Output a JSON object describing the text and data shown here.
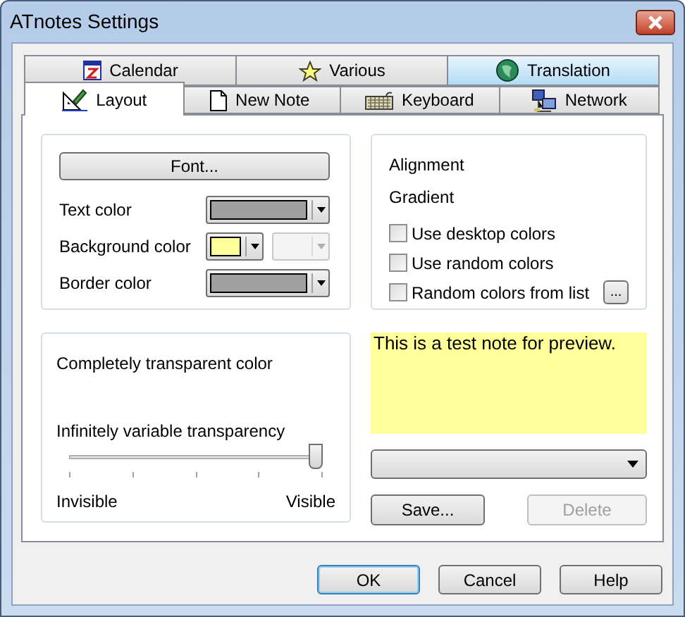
{
  "window": {
    "title": "ATnotes Settings"
  },
  "tab_rows": [
    [
      {
        "label": "Calendar",
        "selected": false,
        "highlighted": false
      },
      {
        "label": "Various",
        "selected": false,
        "highlighted": false
      },
      {
        "label": "Translation",
        "selected": false,
        "highlighted": true
      }
    ],
    [
      {
        "label": "Layout",
        "selected": true,
        "highlighted": false
      },
      {
        "label": "New Note",
        "selected": false,
        "highlighted": false
      },
      {
        "label": "Keyboard",
        "selected": false,
        "highlighted": false
      },
      {
        "label": "Network",
        "selected": false,
        "highlighted": false
      }
    ]
  ],
  "font_button": "Font...",
  "color_rows": [
    {
      "label": "Text color",
      "pickers": [
        {
          "color": "#a0a0a0",
          "disabled": false,
          "wide": true
        }
      ]
    },
    {
      "label": "Background color",
      "pickers": [
        {
          "color": "#ffff99",
          "disabled": false,
          "wide": false
        },
        {
          "color": "#f4f4f4",
          "disabled": true,
          "wide": false
        }
      ]
    },
    {
      "label": "Border color",
      "pickers": [
        {
          "color": "#a0a0a0",
          "disabled": false,
          "wide": true
        }
      ]
    }
  ],
  "options": {
    "alignment": "Alignment",
    "gradient": "Gradient",
    "checkboxes": [
      {
        "label": "Use desktop colors",
        "checked": false
      },
      {
        "label": "Use random colors",
        "checked": false
      },
      {
        "label": "Random colors from list",
        "checked": false
      }
    ],
    "list_button": "..."
  },
  "transparency": {
    "transparent_label": "Completely transparent color",
    "slider_label": "Infinitely variable transparency",
    "level": 1,
    "min_label": "Invisible",
    "max_label": "Visible"
  },
  "preview": {
    "text": "This is a test note for preview.",
    "color": "#ffff99"
  },
  "scheme_dropdown": {
    "expanded": false
  },
  "scheme_buttons": [
    {
      "label": "Save...",
      "disabled": false
    },
    {
      "label": "Delete",
      "disabled": true
    }
  ],
  "dialog_buttons": [
    {
      "label": "OK",
      "default": true
    },
    {
      "label": "Cancel",
      "default": false
    },
    {
      "label": "Help",
      "default": false
    }
  ]
}
